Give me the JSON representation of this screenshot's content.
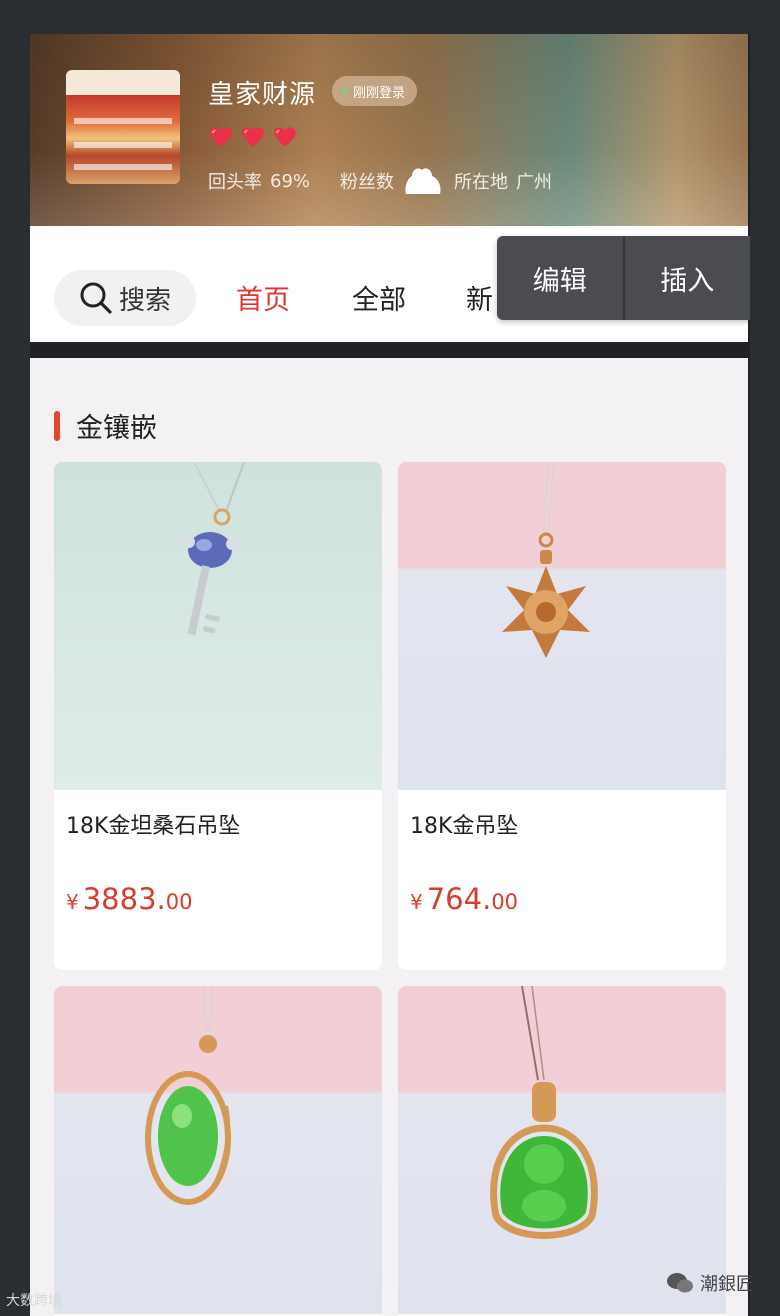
{
  "shop": {
    "name": "皇家财源",
    "login_status": "刚刚登录",
    "hearts": 3,
    "repeat_label": "回头率",
    "repeat_value": "69%",
    "fans_label": "粉丝数",
    "location_label": "所在地",
    "location_value": "广州"
  },
  "nav": {
    "search_label": "搜索",
    "tabs": [
      {
        "label": "首页",
        "active": true
      },
      {
        "label": "全部",
        "active": false
      },
      {
        "label": "新",
        "active": false
      }
    ]
  },
  "popup": {
    "edit_label": "编辑",
    "insert_label": "插入"
  },
  "section": {
    "title": "金镶嵌"
  },
  "products": [
    {
      "name": "18K金坦桑石吊坠",
      "currency": "¥",
      "price_int": "3883.",
      "price_dec": "00"
    },
    {
      "name": "18K金吊坠",
      "currency": "¥",
      "price_int": "764.",
      "price_dec": "00"
    },
    {
      "name": "",
      "currency": "",
      "price_int": "",
      "price_dec": ""
    },
    {
      "name": "",
      "currency": "",
      "price_int": "",
      "price_dec": ""
    }
  ],
  "watermarks": {
    "left": "大数跨境",
    "right": "潮銀匠"
  },
  "colors": {
    "accent_red": "#e0352b",
    "price_red": "#d93b2e",
    "popup_bg": "#4a4c51"
  }
}
